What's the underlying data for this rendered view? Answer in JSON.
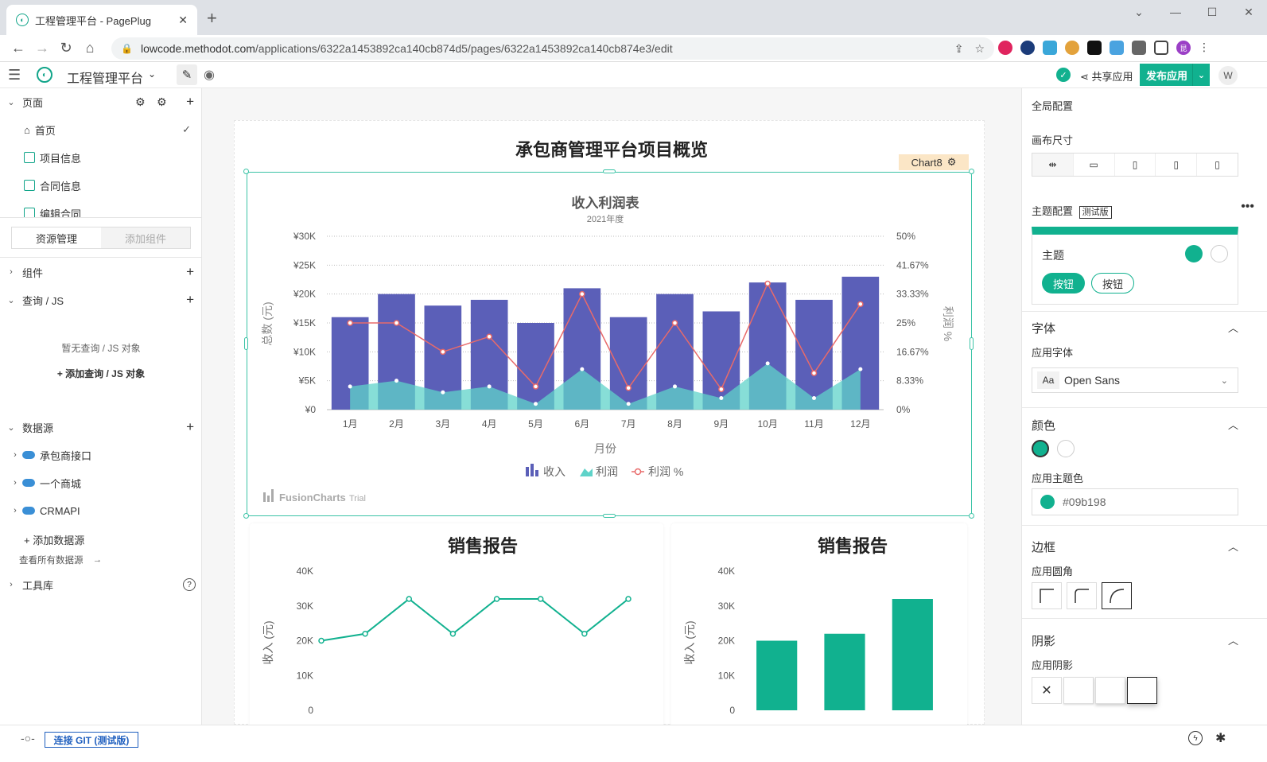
{
  "browser": {
    "tab_title": "工程管理平台 - PagePlug",
    "url_host": "lowcode.methodot.com",
    "url_path": "/applications/6322a1453892ca140cb874d5/pages/6322a1453892ca140cb874e3/edit",
    "profile_initial": "昆"
  },
  "app": {
    "name": "工程管理平台",
    "share_label": "共享应用",
    "publish_label": "发布应用",
    "user_initial": "W"
  },
  "sidebar": {
    "pages_title": "页面",
    "pages": [
      {
        "label": "首页"
      },
      {
        "label": "项目信息"
      },
      {
        "label": "合同信息"
      },
      {
        "label": "编辑合同"
      }
    ],
    "tabs": {
      "active": "资源管理",
      "inactive": "添加组件"
    },
    "components_label": "组件",
    "queries_label": "查询 / JS",
    "no_query_text": "暂无查询 / JS 对象",
    "add_query_label": "+ 添加查询 / JS 对象",
    "datasources_label": "数据源",
    "datasources": [
      {
        "label": "承包商接口"
      },
      {
        "label": "一个商城"
      },
      {
        "label": "CRMAPI"
      }
    ],
    "add_datasource_label": "+ 添加数据源",
    "view_all_label": "查看所有数据源",
    "toolbox_label": "工具库"
  },
  "canvas": {
    "page_title": "承包商管理平台项目概览",
    "selected_widget": "Chart8",
    "watermark": "FusionCharts",
    "watermark_suffix": "Trial"
  },
  "chart_data": [
    {
      "type": "bar",
      "title": "收入利润表",
      "subtitle": "2021年度",
      "xlabel": "月份",
      "ylabel": "总数 (元)",
      "y2label": "利润 %",
      "categories": [
        "1月",
        "2月",
        "3月",
        "4月",
        "5月",
        "6月",
        "7月",
        "8月",
        "9月",
        "10月",
        "11月",
        "12月"
      ],
      "ylim": [
        0,
        30000
      ],
      "yticks": [
        "¥0",
        "¥5K",
        "¥10K",
        "¥15K",
        "¥20K",
        "¥25K",
        "¥30K"
      ],
      "y2lim": [
        0,
        50
      ],
      "y2ticks": [
        "0%",
        "8.33%",
        "16.67%",
        "25%",
        "33.33%",
        "41.67%",
        "50%"
      ],
      "series": [
        {
          "name": "收入",
          "type": "bar",
          "color": "#5b5fb8",
          "values": [
            16000,
            20000,
            18000,
            19000,
            15000,
            21000,
            16000,
            20000,
            17000,
            22000,
            19000,
            23000
          ]
        },
        {
          "name": "利润",
          "type": "area",
          "color": "#5fd3c9",
          "values": [
            4000,
            5000,
            3000,
            4000,
            1000,
            7000,
            1000,
            4000,
            2000,
            8000,
            2000,
            7000
          ]
        },
        {
          "name": "利润 %",
          "type": "line",
          "color": "#e86a6a",
          "axis": "y2",
          "values": [
            25,
            25,
            16.67,
            21.05,
            6.67,
            33.33,
            6.25,
            25,
            5.88,
            36.36,
            10.53,
            30.43
          ]
        }
      ],
      "legend": "bottom",
      "grid": true
    },
    {
      "type": "line",
      "title": "销售报告",
      "ylabel": "收入 (元)",
      "ylim": [
        0,
        40000
      ],
      "yticks": [
        "0",
        "10K",
        "20K",
        "30K",
        "40K"
      ],
      "color": "#11b18f",
      "values": [
        20000,
        22000,
        32000,
        22000,
        32000,
        32000,
        22000,
        32000
      ]
    },
    {
      "type": "bar",
      "title": "销售报告",
      "ylabel": "收入 (元)",
      "ylim": [
        0,
        40000
      ],
      "yticks": [
        "0",
        "10K",
        "20K",
        "30K",
        "40K"
      ],
      "color": "#11b18f",
      "values": [
        20000,
        22000,
        32000
      ]
    }
  ],
  "props": {
    "global_config": "全局配置",
    "canvas_size": "画布尺寸",
    "theme_config": "主题配置",
    "beta": "测试版",
    "theme_label": "主题",
    "button_label": "按钮",
    "font_section": "字体",
    "app_font": "应用字体",
    "font_value": "Open Sans",
    "font_prefix": "Aa",
    "color_section": "颜色",
    "app_theme_color": "应用主题色",
    "color_value": "#09b198",
    "border_section": "边框",
    "app_radius": "应用圆角",
    "shadow_section": "阴影",
    "app_shadow": "应用阴影",
    "primary_color": "#11b18f"
  },
  "status": {
    "git_label": "连接 GIT (测试版)"
  }
}
